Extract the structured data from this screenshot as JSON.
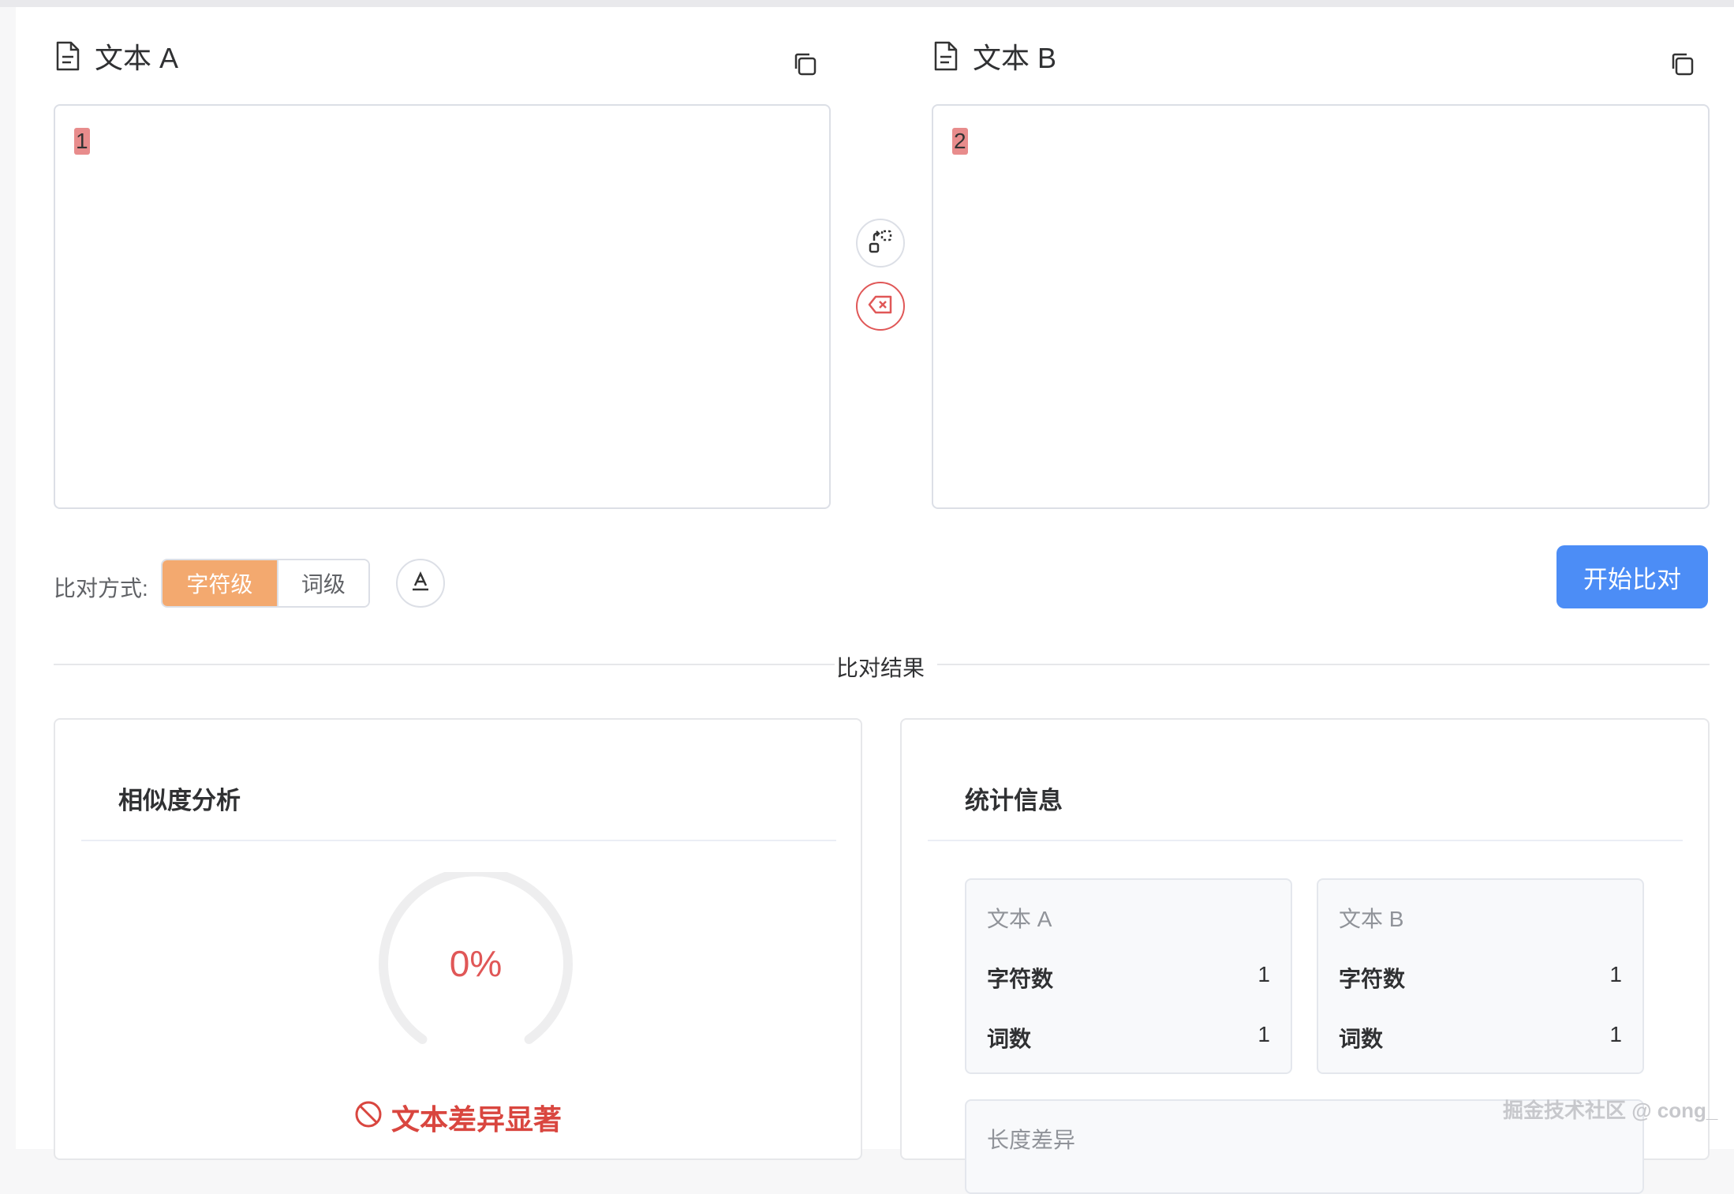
{
  "editors": {
    "a": {
      "title": "文本 A",
      "content": "1",
      "icon": "document-icon",
      "copy_icon": "copy-icon"
    },
    "b": {
      "title": "文本 B",
      "content": "2",
      "icon": "document-icon",
      "copy_icon": "copy-icon"
    }
  },
  "side_actions": {
    "swap_icon": "swap-icon",
    "clear_icon": "clear-icon"
  },
  "compare": {
    "mode_label": "比对方式:",
    "modes": [
      {
        "label": "字符级",
        "active": true
      },
      {
        "label": "词级",
        "active": false
      }
    ],
    "font_icon": "text-format-icon",
    "start_label": "开始比对"
  },
  "results": {
    "divider_label": "比对结果",
    "similarity": {
      "title": "相似度分析",
      "percent_text": "0%",
      "percent_value": 0,
      "verdict": "文本差异显著",
      "verdict_icon": "no-sign-icon"
    },
    "stats": {
      "title": "统计信息",
      "text_a": {
        "label": "文本 A",
        "rows": [
          {
            "key": "字符数",
            "value": "1"
          },
          {
            "key": "词数",
            "value": "1"
          }
        ]
      },
      "text_b": {
        "label": "文本 B",
        "rows": [
          {
            "key": "字符数",
            "value": "1"
          },
          {
            "key": "词数",
            "value": "1"
          }
        ]
      },
      "length_diff_label": "长度差异"
    }
  },
  "watermark": "掘金技术社区 @ cong_",
  "colors": {
    "accent": "#f3a96f",
    "primary": "#4c8df6",
    "danger": "#e05757"
  }
}
